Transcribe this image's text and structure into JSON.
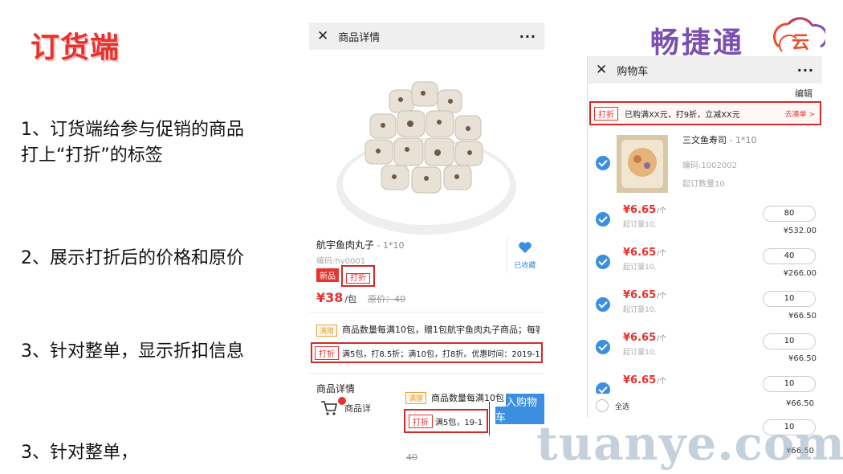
{
  "slide": {
    "title": "订货端",
    "bullets": [
      "1、订货端给参与促销的商品\n打上“打折”的标签",
      "2、展示打折后的价格和原价",
      "3、针对整单，显示折扣信息",
      "3、针对整单，"
    ]
  },
  "brand": {
    "name": "畅捷通",
    "logo_glyph": "云",
    "colors": [
      "#7a4fb0",
      "#c0395a",
      "#e84e2a"
    ]
  },
  "watermark": "tuanye.com",
  "product_page": {
    "header_title": "商品详情",
    "close_icon": "close-icon",
    "more_icon": "more-icon",
    "product_name": "航宇鱼肉丸子",
    "product_spec": " - 1*10",
    "product_code": "编码:hy0001",
    "tag_new": "新品",
    "tag_discount": "打折",
    "price": "¥38",
    "price_unit": "/包",
    "original_price": "原价：40",
    "favorite_label": "已收藏",
    "promo_tag": "满赠",
    "promo_text": "商品数量每满10包，赠1包航宇鱼肉丸子商品；每客...",
    "discount_tag": "打折",
    "discount_text": "满5包，打8.5折；满10包，打8折。优惠时间：2019-1...",
    "detail_label": "商品详情",
    "bottom_label": "商品详",
    "add_to_cart": "加入购物车"
  },
  "fragments": {
    "promo_tag": "满赠",
    "promo_text": "商品数量每满10包",
    "discount_tag": "打折",
    "discount_text": "满5包，19-1",
    "orig_price": "40"
  },
  "cart_page": {
    "header_title": "购物车",
    "edit": "编辑",
    "banner_tag": "打折",
    "banner_text": "已购满XX元，打9折，立减XX元",
    "banner_link": "去凑单 >",
    "product_name": "三文鱼寿司",
    "product_spec": " - 1*10",
    "product_code": "编码:1002002",
    "moq": "起订数量10",
    "items": [
      {
        "price": "¥6.65",
        "per": "/个",
        "moq": "起订量10,",
        "qty": "80",
        "total": "¥532.00"
      },
      {
        "price": "¥6.65",
        "per": "/个",
        "moq": "起订量10,",
        "qty": "40",
        "total": "¥266.00"
      },
      {
        "price": "¥6.65",
        "per": "/个",
        "moq": "起订量10,",
        "qty": "10",
        "total": "¥66.50"
      },
      {
        "price": "¥6.65",
        "per": "/个",
        "moq": "起订量10,",
        "qty": "10",
        "total": "¥66.50"
      },
      {
        "price": "¥6.65",
        "per": "/个",
        "moq": "",
        "qty": "10",
        "total": ""
      }
    ],
    "select_all": "全选",
    "footer_total": "¥66.50",
    "extra_qty": "10",
    "extra_total": "¥66.50"
  }
}
